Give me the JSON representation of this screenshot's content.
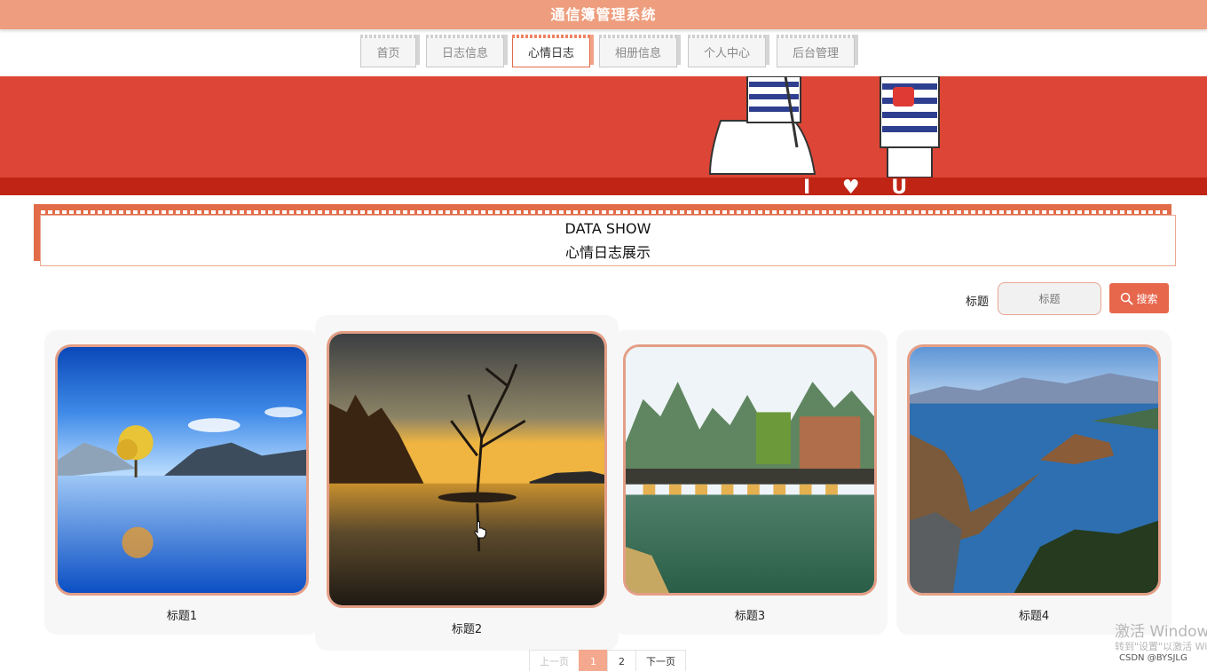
{
  "header": {
    "title": "通信簿管理系统"
  },
  "nav": {
    "items": [
      {
        "label": "首页"
      },
      {
        "label": "日志信息"
      },
      {
        "label": "心情日志"
      },
      {
        "label": "相册信息"
      },
      {
        "label": "个人中心"
      },
      {
        "label": "后台管理"
      }
    ],
    "active": "心情日志"
  },
  "banner": {
    "art_text": "I ♥ U"
  },
  "section": {
    "title_en": "DATA SHOW",
    "title_cn": "心情日志展示"
  },
  "search": {
    "label": "标题",
    "placeholder": "标题",
    "button_label": "搜索"
  },
  "cards": [
    {
      "caption": "标题1"
    },
    {
      "caption": "标题2"
    },
    {
      "caption": "标题3"
    },
    {
      "caption": "标题4"
    }
  ],
  "pagination": {
    "prev": "上一页",
    "pages": [
      "1",
      "2"
    ],
    "current": "1",
    "next": "下一页"
  },
  "watermark": {
    "line1": "激活 Windows",
    "line2": "转到\"设置\"以激活 Windows",
    "credit": "CSDN @BYSJLG"
  },
  "colors": {
    "header": "#ee9e7e",
    "accent": "#e26b48",
    "banner": "#dd4636",
    "search_button": "#e7674d",
    "page_current": "#f4a88e"
  }
}
